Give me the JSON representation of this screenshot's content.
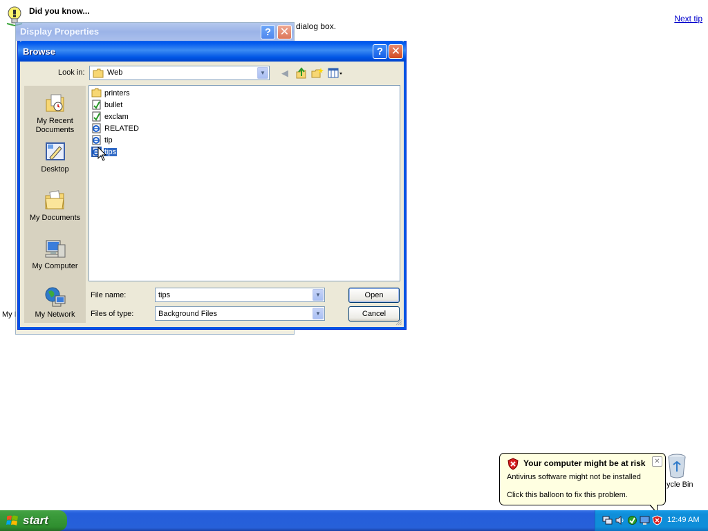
{
  "tip_page": {
    "title": "Did you know...",
    "next_tip": "Next tip",
    "body_fragment": "dialog box.",
    "desktop_fragment": "My I"
  },
  "display_properties": {
    "title": "Display Properties",
    "help": "?",
    "close": "✕"
  },
  "browse": {
    "title": "Browse",
    "help": "?",
    "close": "✕",
    "look_in_label": "Look in:",
    "look_in_value": "Web",
    "places": [
      {
        "label": "My Recent\nDocuments",
        "icon": "recent-documents-icon"
      },
      {
        "label": "Desktop",
        "icon": "desktop-icon"
      },
      {
        "label": "My Documents",
        "icon": "my-documents-icon"
      },
      {
        "label": "My Computer",
        "icon": "my-computer-icon"
      },
      {
        "label": "My Network",
        "icon": "my-network-icon"
      }
    ],
    "files": [
      {
        "name": "printers",
        "icon": "folder-icon"
      },
      {
        "name": "bullet",
        "icon": "image-file-icon"
      },
      {
        "name": "exclam",
        "icon": "image-file-icon"
      },
      {
        "name": "RELATED",
        "icon": "html-file-icon"
      },
      {
        "name": "tip",
        "icon": "html-file-icon"
      },
      {
        "name": "tips",
        "icon": "html-file-icon",
        "selected": true
      }
    ],
    "file_name_label": "File name:",
    "file_name_value": "tips",
    "files_of_type_label": "Files of type:",
    "files_of_type_value": "Background Files",
    "open_button": "Open",
    "cancel_button": "Cancel"
  },
  "balloon": {
    "title": "Your computer might be at risk",
    "line1": "Antivirus software might not be installed",
    "line2": "Click this balloon to fix this problem.",
    "close": "✕"
  },
  "desktop": {
    "recycle_bin_label": "ycle Bin"
  },
  "taskbar": {
    "start_label": "start",
    "clock": "12:49 AM"
  }
}
